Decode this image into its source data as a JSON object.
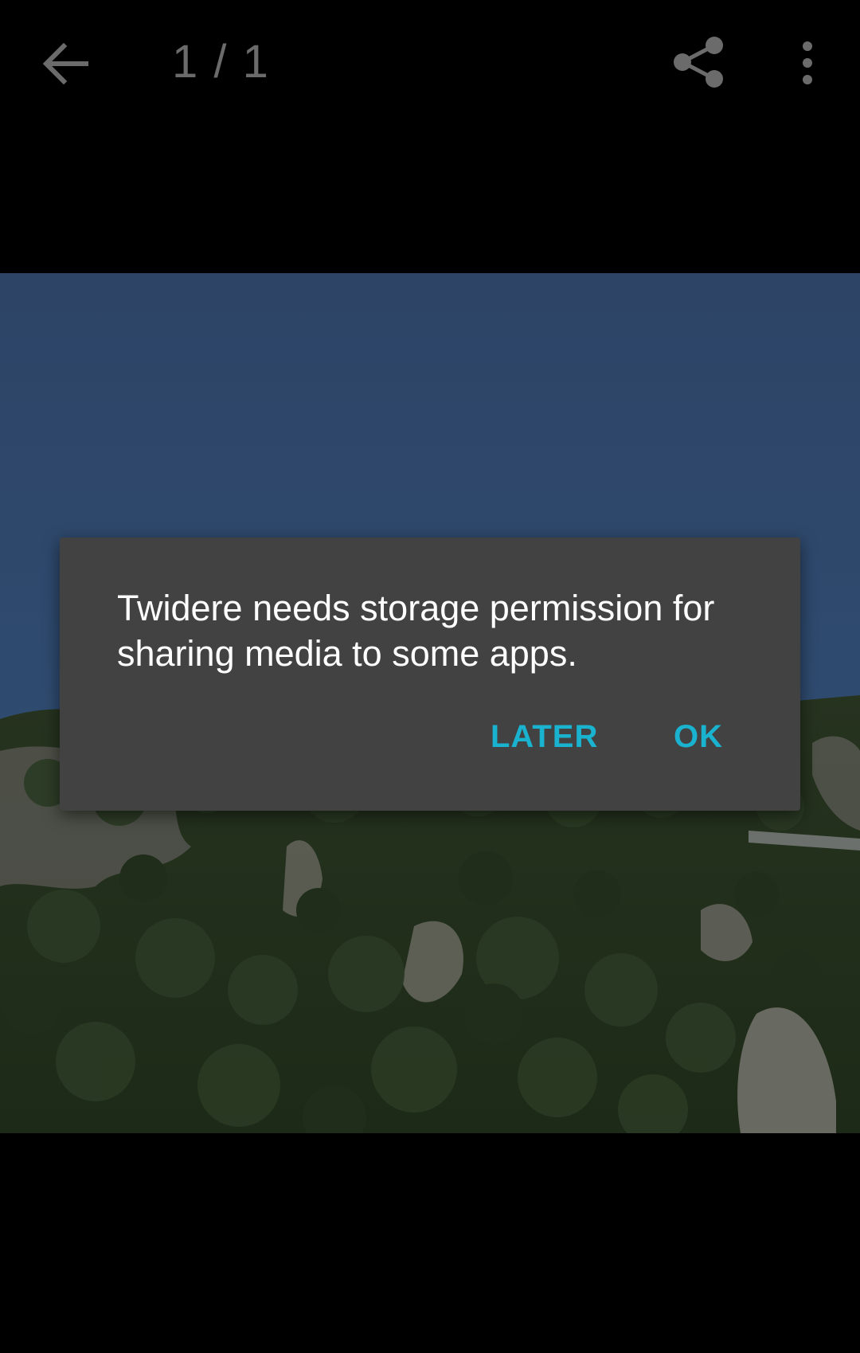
{
  "toolbar": {
    "counter": "1 / 1",
    "back_icon": "arrow-back-icon",
    "share_icon": "share-icon",
    "more_icon": "more-vert-icon"
  },
  "dialog": {
    "message": "Twidere needs storage permission for sharing media to some apps.",
    "later_label": "LATER",
    "ok_label": "OK",
    "accent_color": "#1ab3cf"
  }
}
